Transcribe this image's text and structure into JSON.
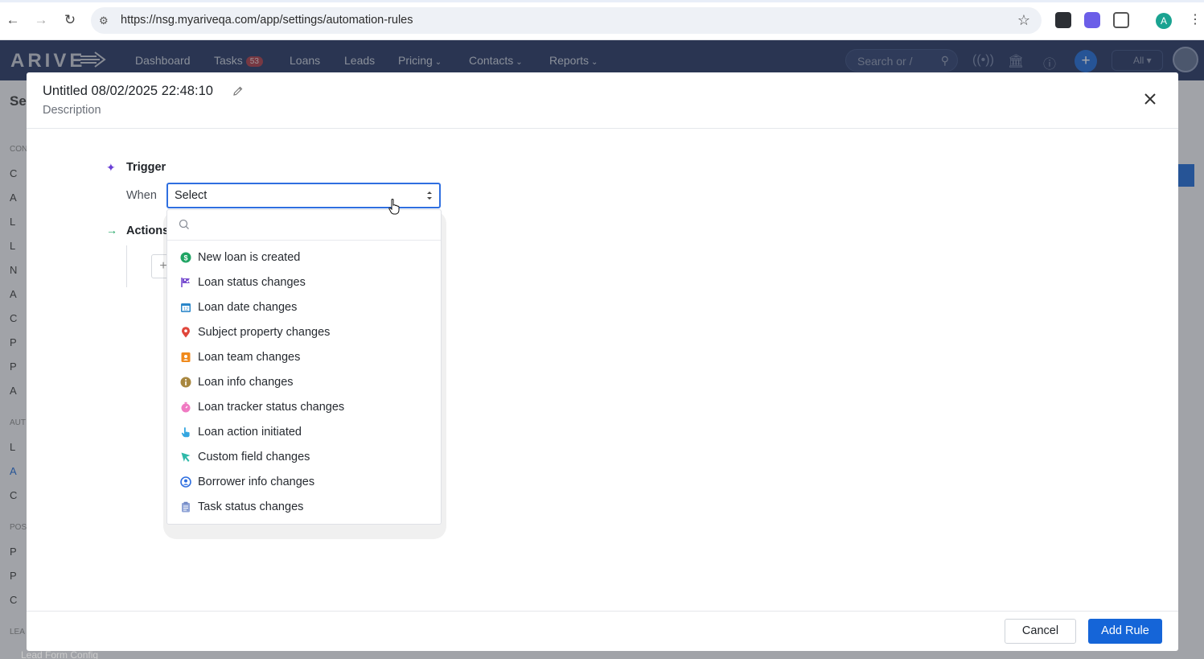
{
  "browser": {
    "url": "https://nsg.myariveqa.com/app/settings/automation-rules",
    "profile_initial": "A"
  },
  "app_header": {
    "logo": "ARIVE",
    "nav": [
      {
        "label": "Dashboard"
      },
      {
        "label": "Tasks",
        "badge": "53"
      },
      {
        "label": "Loans"
      },
      {
        "label": "Leads"
      },
      {
        "label": "Pricing",
        "has_dropdown": true
      },
      {
        "label": "Contacts",
        "has_dropdown": true
      },
      {
        "label": "Reports",
        "has_dropdown": true
      }
    ],
    "search_placeholder": "Search or /",
    "scope_label": "All"
  },
  "background": {
    "page_title_fragment": "Se",
    "section_labels": [
      "CON",
      "AUT",
      "POS",
      "LEA"
    ],
    "sidebar_letters": [
      "C",
      "A",
      "L",
      "L",
      "N",
      "A",
      "C",
      "P",
      "P",
      "A",
      "L",
      "A",
      "C",
      "P",
      "P",
      "C"
    ],
    "bottom_item": "Lead Form Config"
  },
  "modal": {
    "title": "Untitled 08/02/2025 22:48:10",
    "description_placeholder": "Description",
    "trigger": {
      "section_label": "Trigger",
      "when_label": "When",
      "select_value": "Select"
    },
    "actions": {
      "section_label": "Actions"
    },
    "dropdown": {
      "search_placeholder": "",
      "options": [
        {
          "label": "New loan is created",
          "icon": "dollar-circle-icon",
          "color": "#1fa463"
        },
        {
          "label": "Loan status changes",
          "icon": "flag-icon",
          "color": "#7a4fd0"
        },
        {
          "label": "Loan date changes",
          "icon": "calendar-icon",
          "color": "#2a86c9"
        },
        {
          "label": "Subject property changes",
          "icon": "map-pin-icon",
          "color": "#e0463b"
        },
        {
          "label": "Loan team changes",
          "icon": "team-badge-icon",
          "color": "#f08a1c"
        },
        {
          "label": "Loan info changes",
          "icon": "info-icon",
          "color": "#a8873f"
        },
        {
          "label": "Loan tracker status changes",
          "icon": "stopwatch-icon",
          "color": "#f07ac2"
        },
        {
          "label": "Loan action initiated",
          "icon": "hand-pointer-icon",
          "color": "#34a6e0"
        },
        {
          "label": "Custom field changes",
          "icon": "cursor-arrow-icon",
          "color": "#2fb9a9"
        },
        {
          "label": "Borrower info changes",
          "icon": "user-circle-icon",
          "color": "#2f6fe0"
        },
        {
          "label": "Task status changes",
          "icon": "clipboard-icon",
          "color": "#8fa3d6"
        }
      ]
    },
    "footer": {
      "cancel_label": "Cancel",
      "add_label": "Add Rule"
    }
  }
}
